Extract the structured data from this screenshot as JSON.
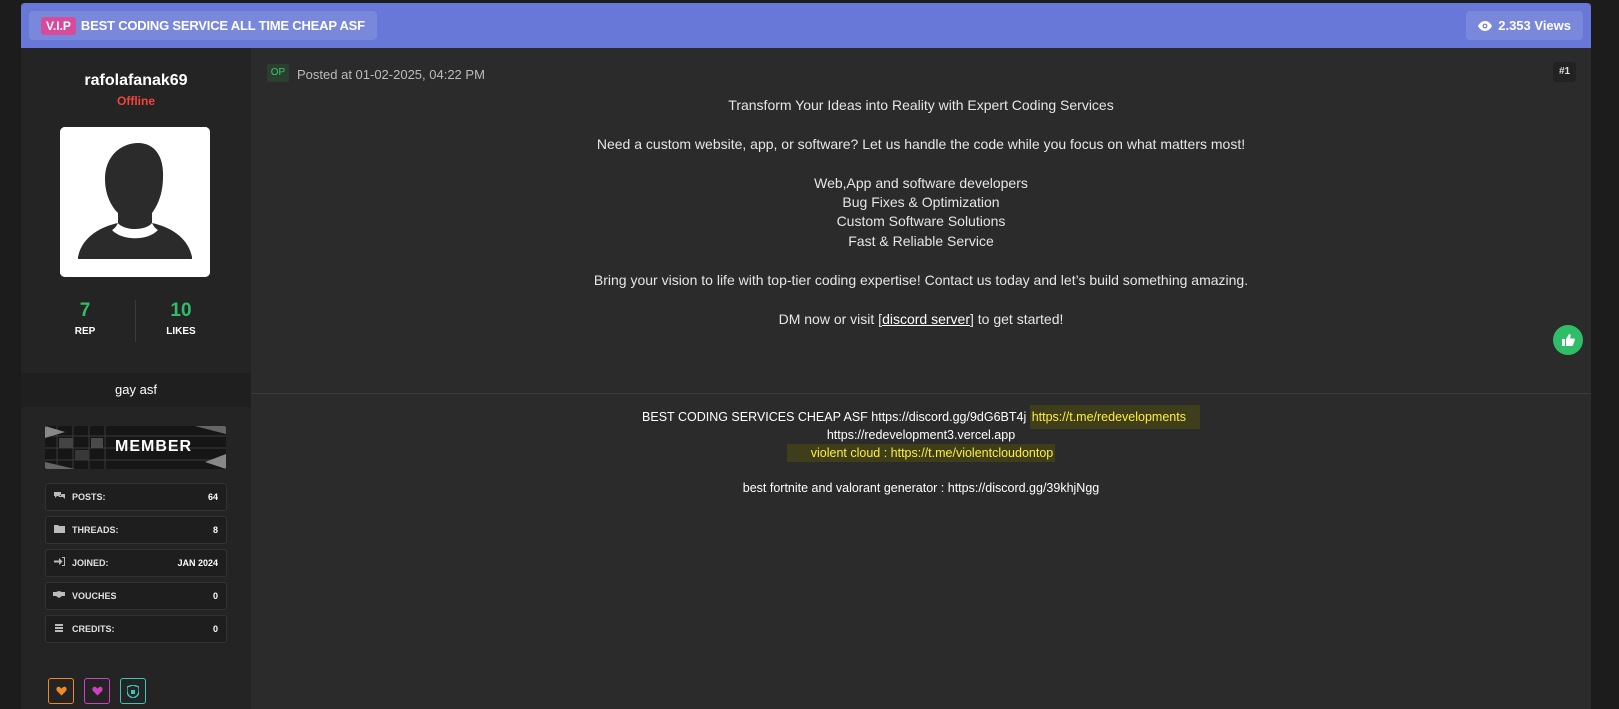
{
  "thread": {
    "badge": "V.I.P",
    "title": "BEST CODING SERVICE ALL TIME CHEAP ASF",
    "views": "2.353 Views"
  },
  "user": {
    "name": "rafolafanak69",
    "status": "Offline",
    "rep": "7",
    "rep_label": "REP",
    "likes": "10",
    "likes_label": "LIKES",
    "usertitle": "gay asf",
    "banner": "MEMBER",
    "info": [
      {
        "label": "POSTS:",
        "value": "64",
        "icon": "chat-icon"
      },
      {
        "label": "THREADS:",
        "value": "8",
        "icon": "folder-icon"
      },
      {
        "label": "JOINED:",
        "value": "JAN 2024",
        "icon": "sign-in-icon"
      },
      {
        "label": "VOUCHES",
        "value": "0",
        "icon": "handshake-icon"
      },
      {
        "label": "CREDITS:",
        "value": "0",
        "icon": "coins-icon"
      }
    ]
  },
  "post": {
    "op": "OP",
    "posted": "Posted at 01-02-2025, 04:22 PM",
    "number": "#1",
    "lines": [
      "Transform Your Ideas into Reality with Expert Coding Services",
      "Need a custom website, app, or software? Let us handle the code while you focus on what matters most!",
      "Web,App and software developers",
      "Bug Fixes & Optimization",
      "Custom Software Solutions",
      "Fast & Reliable Service",
      "Bring your vision to life with top-tier coding expertise!  Contact us today and let’s build something amazing."
    ],
    "cta_prefix": "DM now or visit [",
    "cta_link": "discord server",
    "cta_suffix": "] to get started!"
  },
  "signature": {
    "line1_text": "BEST CODING SERVICES CHEAP ASF https://discord.gg/9dG6BT4j ",
    "line1_highlight": "https://t.me/redevelopments",
    "line2": "https://redevelopment3.vercel.app",
    "line3_highlight": "violent cloud : https://t.me/violentcloudontop",
    "line4": "best fortnite and valorant generator : https://discord.gg/39khjNgg"
  },
  "colors": {
    "header": "#6878d8",
    "accent_green": "#2fbe67",
    "offline_red": "#f0453a",
    "vip_pink": "#d84a9c",
    "highlight_yellow": "#ffef3a"
  }
}
